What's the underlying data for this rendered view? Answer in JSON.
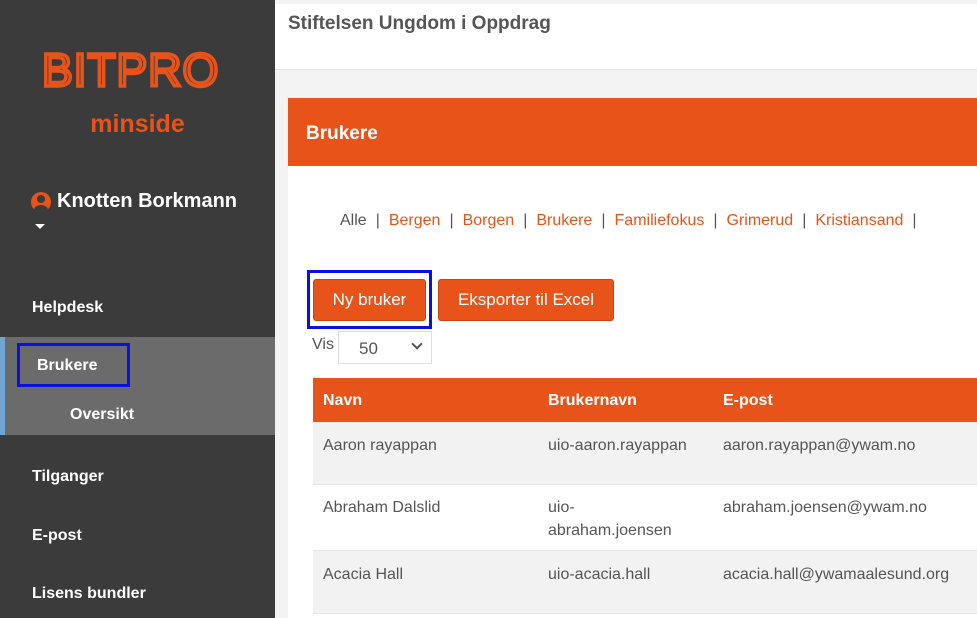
{
  "sidebar": {
    "logo_text": "BITPRO",
    "subtitle": "minside",
    "user_name": "Knotten Borkmann",
    "nav": {
      "helpdesk": "Helpdesk",
      "brukere": "Brukere",
      "oversikt": "Oversikt",
      "tilganger": "Tilganger",
      "epost": "E-post",
      "lisens": "Lisens bundler"
    }
  },
  "header": {
    "org_name": "Stiftelsen Ungdom i Oppdrag"
  },
  "panel": {
    "title": "Brukere",
    "filters": [
      "Alle",
      "Bergen",
      "Borgen",
      "Brukere",
      "Familiefokus",
      "Grimerud",
      "Kristiansand"
    ],
    "new_user_label": "Ny bruker",
    "export_label": "Eksporter til Excel",
    "show_label": "Vis",
    "page_size": "50"
  },
  "table": {
    "headers": {
      "name": "Navn",
      "username": "Brukernavn",
      "email": "E-post"
    },
    "rows": [
      {
        "name": "Aaron rayappan",
        "username": "uio-aaron.rayappan",
        "email": "aaron.rayappan@ywam.no"
      },
      {
        "name": "Abraham Dalslid",
        "username_line1": "uio-",
        "username_line2": "abraham.joensen",
        "email": "abraham.joensen@ywam.no"
      },
      {
        "name": "Acacia Hall",
        "username": "uio-acacia.hall",
        "email": "acacia.hall@ywamaalesund.org"
      }
    ]
  },
  "colors": {
    "accent": "#e8531a",
    "sidebar_bg": "#3b3b3b",
    "highlight_box": "#0a10e0"
  }
}
